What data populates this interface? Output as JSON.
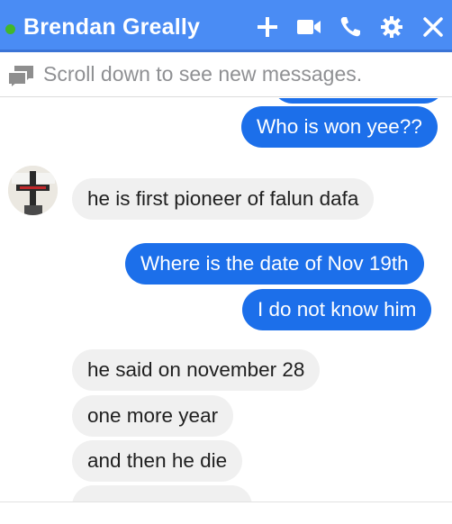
{
  "header": {
    "contact_name": "Brendan Greally",
    "status": "online",
    "actions": [
      "add-icon",
      "video-call-icon",
      "phone-icon",
      "settings-icon",
      "close-icon"
    ]
  },
  "notice": {
    "text": "Scroll down to see new messages."
  },
  "messages": [
    {
      "from": "me",
      "text": "Who is won yee??"
    },
    {
      "from": "contact",
      "text": "he is first pioneer of falun dafa"
    },
    {
      "from": "me",
      "text": "Where is the date of Nov 19th"
    },
    {
      "from": "me",
      "text": "I do not know him"
    },
    {
      "from": "contact",
      "text": "he said on november 28"
    },
    {
      "from": "contact",
      "text": "one more year"
    },
    {
      "from": "contact",
      "text": "and then he die"
    }
  ],
  "colors": {
    "header": "#4a8cf4",
    "outgoing_bubble": "#1c6fea",
    "incoming_bubble": "#f0f0f0",
    "online_dot": "#42b72a"
  }
}
